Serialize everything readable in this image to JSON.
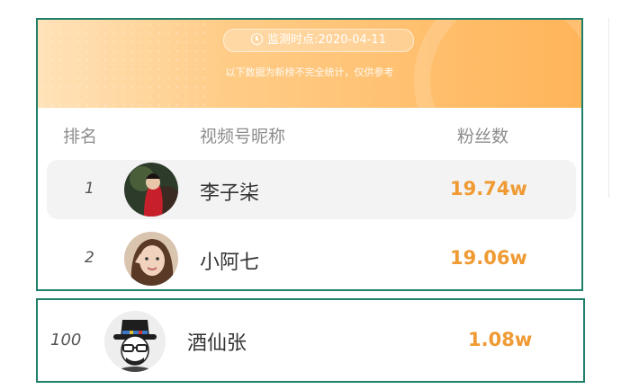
{
  "banner": {
    "date_label": "监测时点:2020-04-11",
    "notice": "以下数据为新榜不完全统计，仅供参考"
  },
  "table": {
    "headers": {
      "rank": "排名",
      "name": "视频号昵称",
      "fans": "粉丝数"
    },
    "rows": [
      {
        "rank": "1",
        "name": "李子柒",
        "fans": "19.74w"
      },
      {
        "rank": "2",
        "name": "小阿七",
        "fans": "19.06w"
      }
    ]
  },
  "highlight_row": {
    "rank": "100",
    "name": "酒仙张",
    "fans": "1.08w"
  },
  "colors": {
    "accent": "#ef9a32",
    "border": "#1f7f6b",
    "banner_start": "#ffe2b8",
    "banner_end": "#ffb55a"
  }
}
